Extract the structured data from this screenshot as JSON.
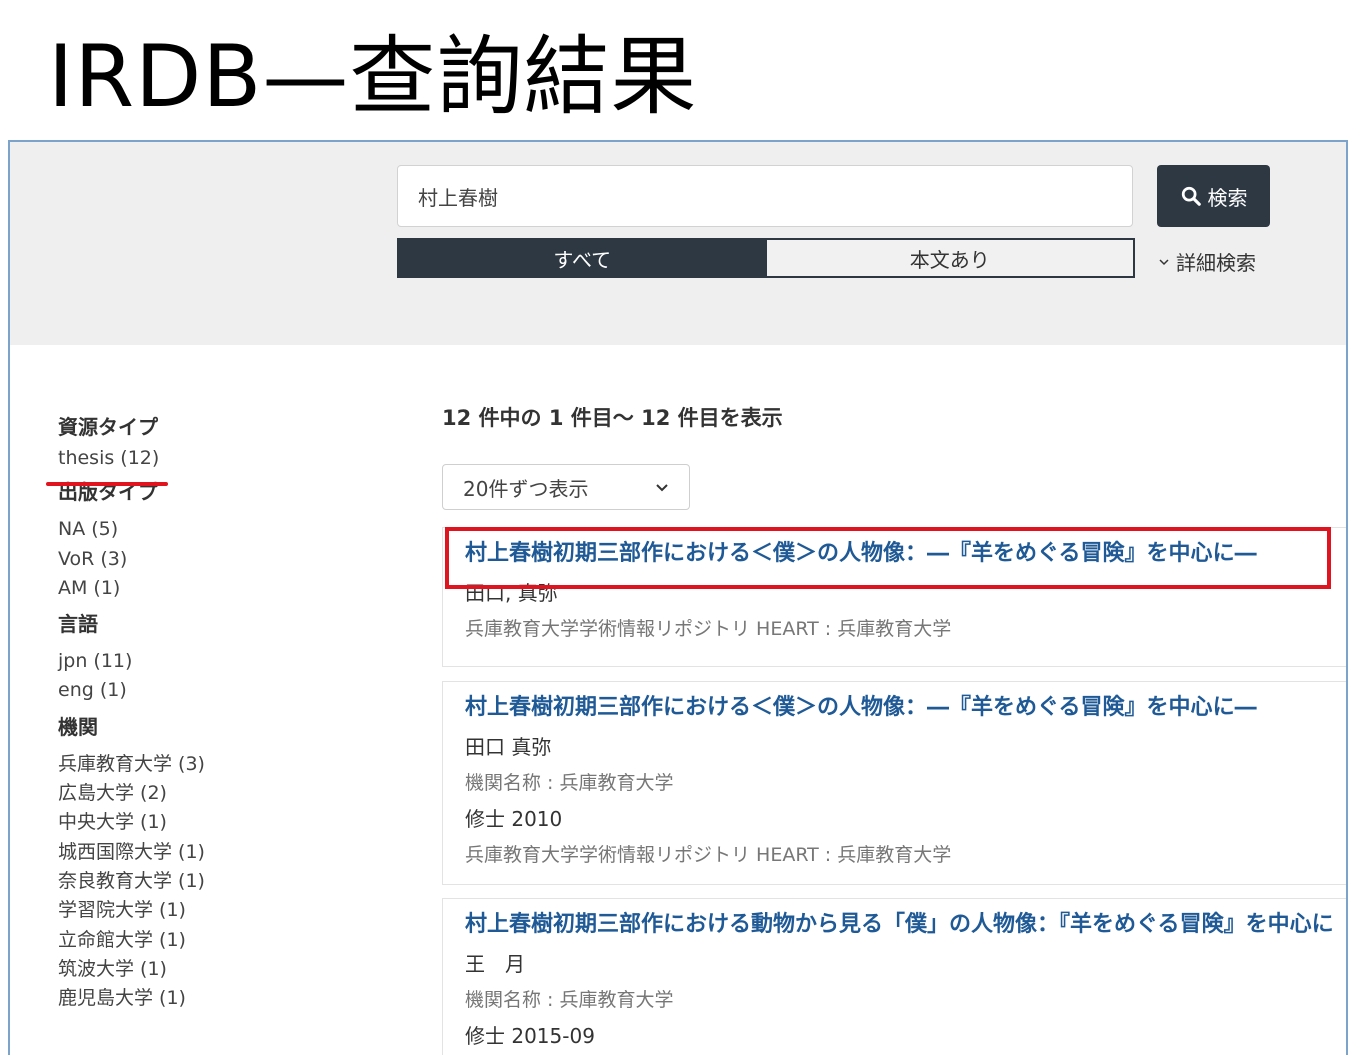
{
  "slide": {
    "title": "IRDB—查詢結果"
  },
  "search": {
    "query": "村上春樹",
    "button_label": "検索",
    "scope_tabs": [
      {
        "label": "すべて",
        "active": true
      },
      {
        "label": "本文あり",
        "active": false
      }
    ],
    "advanced_label": "詳細検索"
  },
  "facets": [
    {
      "heading": "資源タイプ",
      "items": [
        "thesis (12)"
      ]
    },
    {
      "heading": "出版タイプ",
      "items": [
        "NA (5)",
        "VoR (3)",
        "AM (1)"
      ]
    },
    {
      "heading": "言語",
      "items": [
        "jpn (11)",
        "eng (1)"
      ]
    },
    {
      "heading": "機関",
      "items": [
        "兵庫教育大学 (3)",
        "広島大学 (2)",
        "中央大学 (1)",
        "城西国際大学 (1)",
        "奈良教育大学 (1)",
        "学習院大学 (1)",
        "立命館大学 (1)",
        "筑波大学 (1)",
        "鹿児島大学 (1)"
      ]
    }
  ],
  "results": {
    "count_text": "12 件中の 1 件目～ 12 件目を表示",
    "per_page": "20件ずつ表示",
    "items": [
      {
        "title": "村上春樹初期三部作における＜僕＞の人物像：―『羊をめぐる冒険』を中心に―",
        "lines": [
          {
            "text": "田口, 真弥",
            "muted": false
          },
          {
            "text": "兵庫教育大学学術情報リポジトリ HEART : 兵庫教育大学",
            "muted": true
          }
        ]
      },
      {
        "title": "村上春樹初期三部作における＜僕＞の人物像：―『羊をめぐる冒険』を中心に―",
        "lines": [
          {
            "text": "田口 真弥",
            "muted": false
          },
          {
            "text": "機関名称 : 兵庫教育大学",
            "muted": true
          },
          {
            "text": "修士 2010",
            "muted": false
          },
          {
            "text": "兵庫教育大学学術情報リポジトリ HEART : 兵庫教育大学",
            "muted": true
          }
        ]
      },
      {
        "title": "村上春樹初期三部作における動物から見る「僕」の人物像：『羊をめぐる冒険』を中心に",
        "lines": [
          {
            "text": "王　月",
            "muted": false
          },
          {
            "text": "機関名称 : 兵庫教育大学",
            "muted": true
          },
          {
            "text": "修士 2015-09",
            "muted": false
          }
        ]
      }
    ]
  },
  "colors": {
    "accent_dark": "#2d3843",
    "link": "#1f5a96",
    "annotation_red": "#e0141e"
  }
}
